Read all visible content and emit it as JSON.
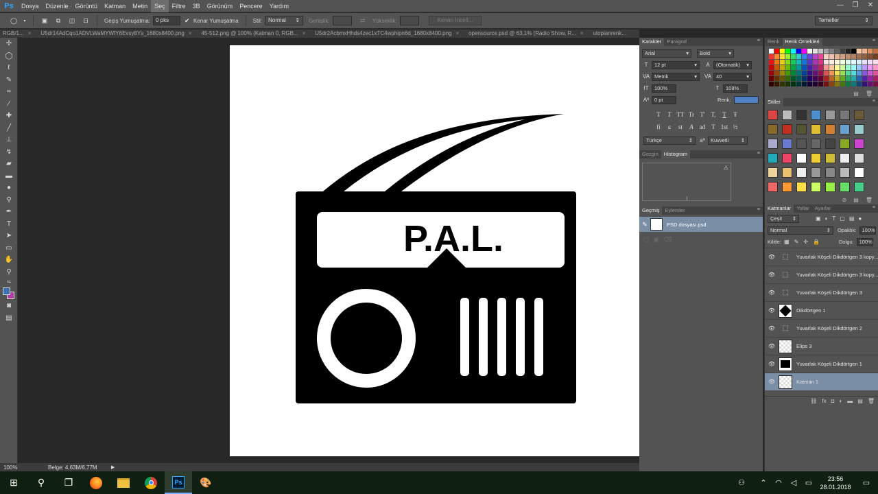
{
  "menubar": {
    "logo": "Ps",
    "items": [
      "Dosya",
      "Düzenle",
      "Görüntü",
      "Katman",
      "Metin",
      "Seç",
      "Filtre",
      "3B",
      "Görünüm",
      "Pencere",
      "Yardım"
    ],
    "active_index": 5,
    "window": {
      "minimize": "—",
      "restore": "❐",
      "close": "✕"
    }
  },
  "options": {
    "feather_label": "Geçiş Yumuşatma:",
    "feather_value": "0 pks",
    "antialias_label": "Kenar Yumuşatma",
    "style_label": "Stil:",
    "style_value": "Normal",
    "width_label": "Genişlik:",
    "height_label": "Yükseklik:",
    "refine_button": "Kenarı İncelt...",
    "workspace": "Temeller"
  },
  "tabs": [
    {
      "label": "RGB/1..."
    },
    {
      "label": "U5dr14AdCqo1ADVLWaMYWfY6Evsy8Ys_1680x8400.png"
    },
    {
      "label": "45-512.png @ 100% (Katman 0, RGB..."
    },
    {
      "label": "U5dr2AcbmxHhds4zec1xTC4wphipn6d_1680x8400.png"
    },
    {
      "label": "opensource.psd @ 63,1% (Radio Show, R..."
    },
    {
      "label": "utopianrenk..."
    }
  ],
  "canvas": {
    "radio_text": "P.A.L."
  },
  "status": {
    "zoom": "100%",
    "doc_info": "Belge: 4,63M/6,77M"
  },
  "character": {
    "tabs": [
      "Karakter",
      "Paragraf"
    ],
    "font_family": "Arial",
    "font_style": "Bold",
    "font_size": "12 pt",
    "leading": "(Otomatik)",
    "kerning": "Metrik",
    "tracking": "40",
    "vscale": "100%",
    "hscale": "108%",
    "baseline": "0 pt",
    "color_label": "Renk:",
    "color_value": "#4f7fc4",
    "glyphs_row1": [
      "T",
      "T",
      "TT",
      "Tr",
      "T'",
      "T,",
      "T",
      "Ŧ"
    ],
    "glyphs_row2": [
      "fi",
      "ɕ",
      "st",
      "A",
      "ad",
      "T",
      "1st",
      "½"
    ],
    "language": "Türkçe",
    "antialias": "Kuvvetli",
    "aa_icon": "aa"
  },
  "navigator": {
    "tabs": [
      "Gezgin",
      "Histogram"
    ]
  },
  "history": {
    "tabs": [
      "Geçmiş",
      "Eylemler"
    ],
    "item": "PSD dosyası.psd"
  },
  "swatches": {
    "tabs": [
      "Renk",
      "Renk Örnekleri"
    ]
  },
  "styles": {
    "title": "Stiller"
  },
  "layers": {
    "tabs": [
      "Katmanlar",
      "Yollar",
      "Ayarlar"
    ],
    "filter_kind": "Çeşit",
    "blend_mode": "Normal",
    "opacity_label": "Opaklık:",
    "opacity_value": "100%",
    "lock_label": "Kilitle:",
    "fill_label": "Dolgu:",
    "fill_value": "100%",
    "items": [
      {
        "name": "Yuvarlak Köşeli Dikdörtgen 3 kopy...",
        "thumb": "shape"
      },
      {
        "name": "Yuvarlak Köşeli Dikdörtgen 3 kopy...",
        "thumb": "shape"
      },
      {
        "name": "Yuvarlak Köşeli Dikdörtgen 3",
        "thumb": "shape"
      },
      {
        "name": "Dikdörtgen 1",
        "thumb": "img"
      },
      {
        "name": "Yuvarlak Köşeli Dikdörtgen 2",
        "thumb": "shape"
      },
      {
        "name": "Elips 3",
        "thumb": "img"
      },
      {
        "name": "Yuvarlak Köşeli Dikdörtgen 1",
        "thumb": "img"
      },
      {
        "name": "Katman 1",
        "thumb": "img"
      }
    ],
    "selected_index": 7
  },
  "taskbar": {
    "time": "23:56",
    "date": "28.01.2018"
  }
}
